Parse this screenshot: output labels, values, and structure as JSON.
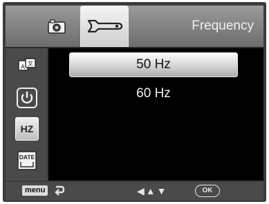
{
  "header": {
    "section_title": "Frequency",
    "tabs": [
      {
        "icon": "camera-icon"
      },
      {
        "icon": "wrench-icon",
        "active": true
      }
    ]
  },
  "sidebar": {
    "items": [
      {
        "icon": "language-icon"
      },
      {
        "icon": "power-icon"
      },
      {
        "icon": "frequency-icon",
        "label": "HZ",
        "active": true
      },
      {
        "icon": "date-icon",
        "label": "DATE"
      }
    ]
  },
  "options": {
    "selected": "50 Hz",
    "other": "60 Hz"
  },
  "footer": {
    "menu_label": "menu",
    "nav_glyphs": "◀▲▼",
    "ok_label": "OK"
  }
}
